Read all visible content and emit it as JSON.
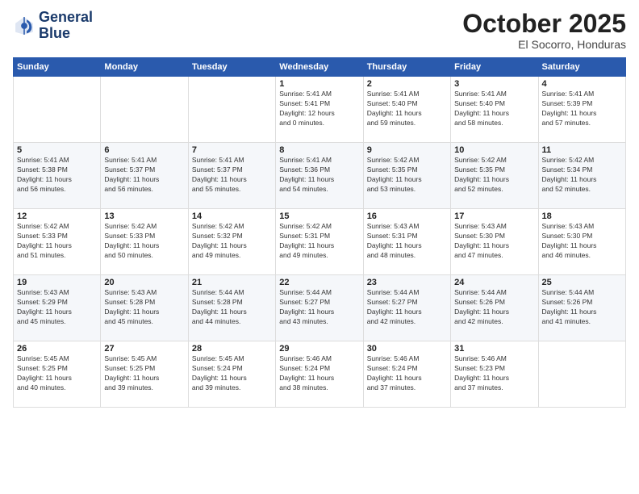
{
  "header": {
    "logo_line1": "General",
    "logo_line2": "Blue",
    "month": "October 2025",
    "location": "El Socorro, Honduras"
  },
  "weekdays": [
    "Sunday",
    "Monday",
    "Tuesday",
    "Wednesday",
    "Thursday",
    "Friday",
    "Saturday"
  ],
  "weeks": [
    [
      {
        "day": "",
        "info": ""
      },
      {
        "day": "",
        "info": ""
      },
      {
        "day": "",
        "info": ""
      },
      {
        "day": "1",
        "info": "Sunrise: 5:41 AM\nSunset: 5:41 PM\nDaylight: 12 hours\nand 0 minutes."
      },
      {
        "day": "2",
        "info": "Sunrise: 5:41 AM\nSunset: 5:40 PM\nDaylight: 11 hours\nand 59 minutes."
      },
      {
        "day": "3",
        "info": "Sunrise: 5:41 AM\nSunset: 5:40 PM\nDaylight: 11 hours\nand 58 minutes."
      },
      {
        "day": "4",
        "info": "Sunrise: 5:41 AM\nSunset: 5:39 PM\nDaylight: 11 hours\nand 57 minutes."
      }
    ],
    [
      {
        "day": "5",
        "info": "Sunrise: 5:41 AM\nSunset: 5:38 PM\nDaylight: 11 hours\nand 56 minutes."
      },
      {
        "day": "6",
        "info": "Sunrise: 5:41 AM\nSunset: 5:37 PM\nDaylight: 11 hours\nand 56 minutes."
      },
      {
        "day": "7",
        "info": "Sunrise: 5:41 AM\nSunset: 5:37 PM\nDaylight: 11 hours\nand 55 minutes."
      },
      {
        "day": "8",
        "info": "Sunrise: 5:41 AM\nSunset: 5:36 PM\nDaylight: 11 hours\nand 54 minutes."
      },
      {
        "day": "9",
        "info": "Sunrise: 5:42 AM\nSunset: 5:35 PM\nDaylight: 11 hours\nand 53 minutes."
      },
      {
        "day": "10",
        "info": "Sunrise: 5:42 AM\nSunset: 5:35 PM\nDaylight: 11 hours\nand 52 minutes."
      },
      {
        "day": "11",
        "info": "Sunrise: 5:42 AM\nSunset: 5:34 PM\nDaylight: 11 hours\nand 52 minutes."
      }
    ],
    [
      {
        "day": "12",
        "info": "Sunrise: 5:42 AM\nSunset: 5:33 PM\nDaylight: 11 hours\nand 51 minutes."
      },
      {
        "day": "13",
        "info": "Sunrise: 5:42 AM\nSunset: 5:33 PM\nDaylight: 11 hours\nand 50 minutes."
      },
      {
        "day": "14",
        "info": "Sunrise: 5:42 AM\nSunset: 5:32 PM\nDaylight: 11 hours\nand 49 minutes."
      },
      {
        "day": "15",
        "info": "Sunrise: 5:42 AM\nSunset: 5:31 PM\nDaylight: 11 hours\nand 49 minutes."
      },
      {
        "day": "16",
        "info": "Sunrise: 5:43 AM\nSunset: 5:31 PM\nDaylight: 11 hours\nand 48 minutes."
      },
      {
        "day": "17",
        "info": "Sunrise: 5:43 AM\nSunset: 5:30 PM\nDaylight: 11 hours\nand 47 minutes."
      },
      {
        "day": "18",
        "info": "Sunrise: 5:43 AM\nSunset: 5:30 PM\nDaylight: 11 hours\nand 46 minutes."
      }
    ],
    [
      {
        "day": "19",
        "info": "Sunrise: 5:43 AM\nSunset: 5:29 PM\nDaylight: 11 hours\nand 45 minutes."
      },
      {
        "day": "20",
        "info": "Sunrise: 5:43 AM\nSunset: 5:28 PM\nDaylight: 11 hours\nand 45 minutes."
      },
      {
        "day": "21",
        "info": "Sunrise: 5:44 AM\nSunset: 5:28 PM\nDaylight: 11 hours\nand 44 minutes."
      },
      {
        "day": "22",
        "info": "Sunrise: 5:44 AM\nSunset: 5:27 PM\nDaylight: 11 hours\nand 43 minutes."
      },
      {
        "day": "23",
        "info": "Sunrise: 5:44 AM\nSunset: 5:27 PM\nDaylight: 11 hours\nand 42 minutes."
      },
      {
        "day": "24",
        "info": "Sunrise: 5:44 AM\nSunset: 5:26 PM\nDaylight: 11 hours\nand 42 minutes."
      },
      {
        "day": "25",
        "info": "Sunrise: 5:44 AM\nSunset: 5:26 PM\nDaylight: 11 hours\nand 41 minutes."
      }
    ],
    [
      {
        "day": "26",
        "info": "Sunrise: 5:45 AM\nSunset: 5:25 PM\nDaylight: 11 hours\nand 40 minutes."
      },
      {
        "day": "27",
        "info": "Sunrise: 5:45 AM\nSunset: 5:25 PM\nDaylight: 11 hours\nand 39 minutes."
      },
      {
        "day": "28",
        "info": "Sunrise: 5:45 AM\nSunset: 5:24 PM\nDaylight: 11 hours\nand 39 minutes."
      },
      {
        "day": "29",
        "info": "Sunrise: 5:46 AM\nSunset: 5:24 PM\nDaylight: 11 hours\nand 38 minutes."
      },
      {
        "day": "30",
        "info": "Sunrise: 5:46 AM\nSunset: 5:24 PM\nDaylight: 11 hours\nand 37 minutes."
      },
      {
        "day": "31",
        "info": "Sunrise: 5:46 AM\nSunset: 5:23 PM\nDaylight: 11 hours\nand 37 minutes."
      },
      {
        "day": "",
        "info": ""
      }
    ]
  ]
}
